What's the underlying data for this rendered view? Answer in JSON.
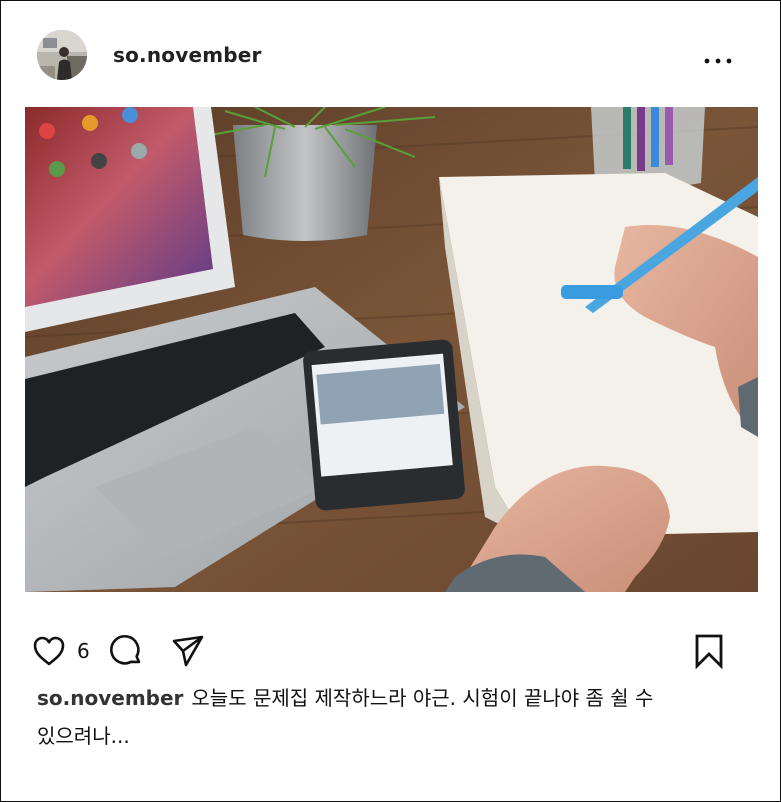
{
  "post": {
    "username": "so.november",
    "more_icon": "ellipsis-icon",
    "photo_alt": "photo",
    "likes": "6",
    "caption_user": "so.november",
    "caption_text": "오늘도 문제집 제작하느라 야근. 시험이 끝나야 좀 쉴 수 있으려나..."
  },
  "actions": {
    "like_icon": "heart-icon",
    "comment_icon": "comment-icon",
    "share_icon": "send-icon",
    "save_icon": "bookmark-icon"
  },
  "colors": {
    "text": "#111111",
    "border": "#111111",
    "background": "#ffffff"
  }
}
